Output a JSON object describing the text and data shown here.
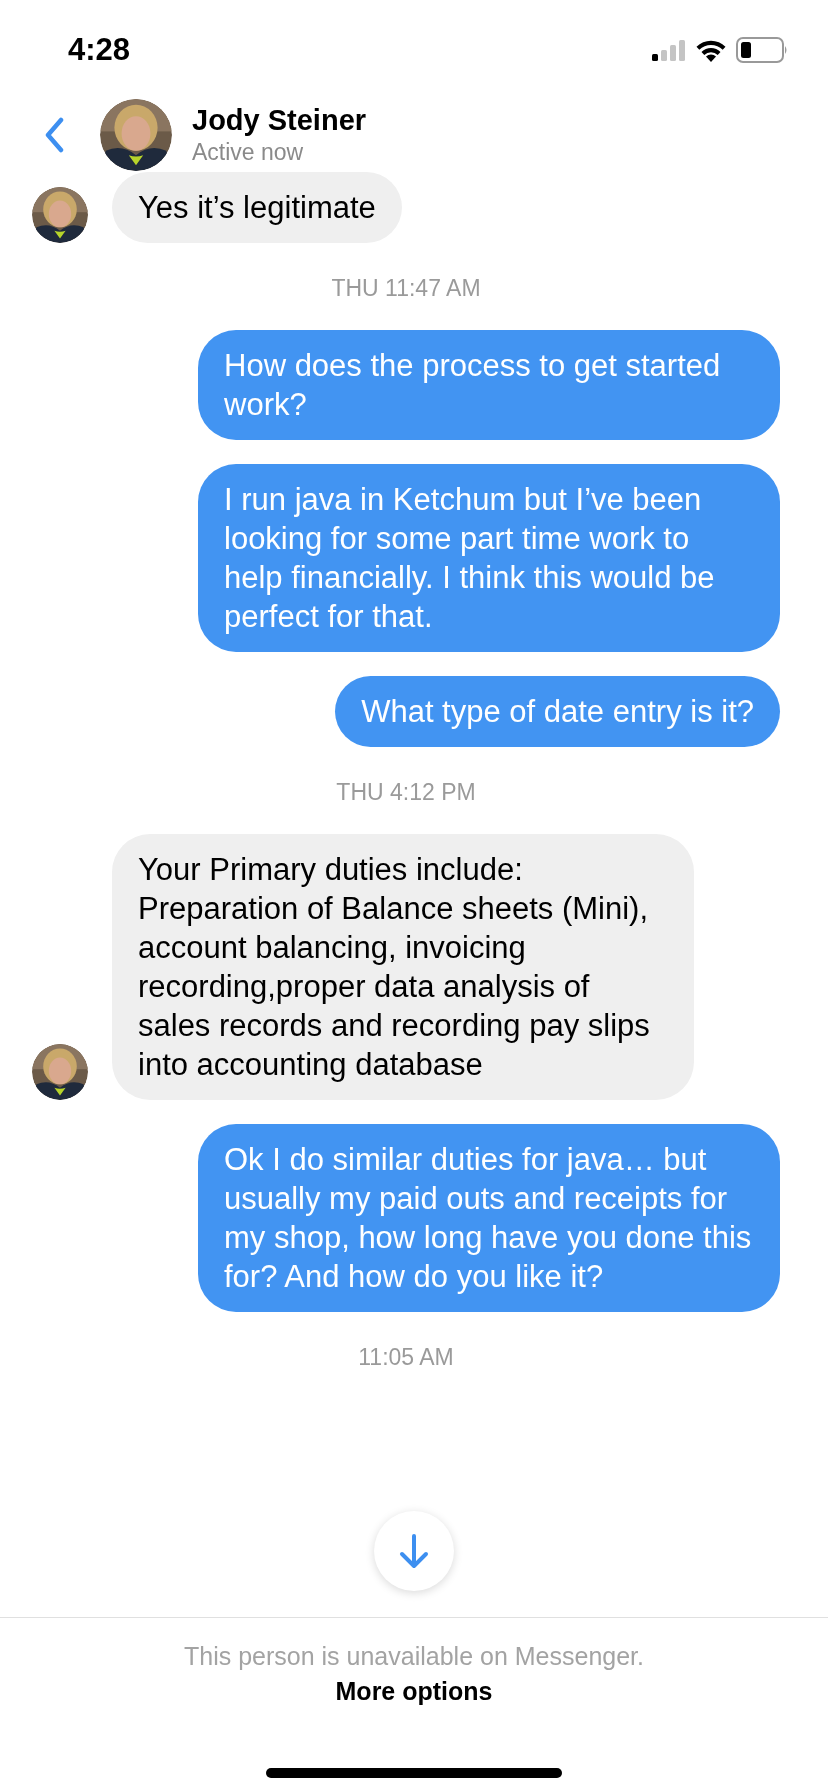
{
  "status_bar": {
    "time": "4:28"
  },
  "header": {
    "name": "Jody Steiner",
    "status": "Active now"
  },
  "messages": [
    {
      "kind": "incoming",
      "text": "Yes it’s legitimate"
    },
    {
      "kind": "timestamp",
      "text": "THU 11:47 AM"
    },
    {
      "kind": "outgoing",
      "text": "How does the process to get started work?"
    },
    {
      "kind": "outgoing",
      "text": "I run java in Ketchum but I’ve been looking for some part time work to help financially. I think this would be perfect for that."
    },
    {
      "kind": "outgoing",
      "text": "What type of date entry is it?"
    },
    {
      "kind": "timestamp",
      "text": "THU 4:12 PM"
    },
    {
      "kind": "incoming",
      "text": "Your Primary duties include: Preparation of Balance sheets (Mini), account balancing, invoicing recording,proper data analysis of sales records and recording pay slips into accounting database"
    },
    {
      "kind": "outgoing",
      "text": "Ok I do similar duties for java… but usually my paid outs and receipts for my shop, how long have you done this for? And how do you like it?"
    },
    {
      "kind": "timestamp",
      "text": "11:05 AM"
    }
  ],
  "footer": {
    "notice": "This person is unavailable on Messenger.",
    "link": "More options"
  }
}
